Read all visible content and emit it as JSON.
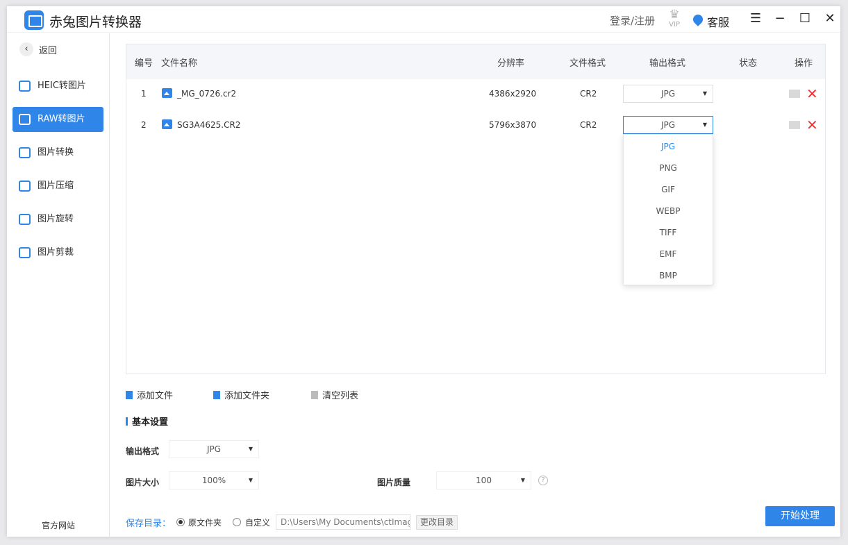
{
  "app": {
    "title": "赤兔图片转换器",
    "login": "登录/注册",
    "vip": "VIP",
    "support": "客服"
  },
  "sidebar": {
    "back": "返回",
    "items": [
      {
        "label": "HEIC转图片",
        "active": false
      },
      {
        "label": "RAW转图片",
        "active": true
      },
      {
        "label": "图片转换",
        "active": false
      },
      {
        "label": "图片压缩",
        "active": false
      },
      {
        "label": "图片旋转",
        "active": false
      },
      {
        "label": "图片剪裁",
        "active": false
      }
    ],
    "website": "官方网站"
  },
  "table": {
    "headers": {
      "num": "编号",
      "name": "文件名称",
      "resolution": "分辨率",
      "format": "文件格式",
      "output": "输出格式",
      "status": "状态",
      "ops": "操作"
    },
    "rows": [
      {
        "num": "1",
        "name": "_MG_0726.cr2",
        "resolution": "4386x2920",
        "format": "CR2",
        "output": "JPG",
        "status": ""
      },
      {
        "num": "2",
        "name": "SG3A4625.CR2",
        "resolution": "5796x3870",
        "format": "CR2",
        "output": "JPG",
        "status": ""
      }
    ]
  },
  "dropdown": {
    "options": [
      "JPG",
      "PNG",
      "GIF",
      "WEBP",
      "TIFF",
      "EMF",
      "BMP"
    ],
    "selected": "JPG"
  },
  "actions": {
    "add_file": "添加文件",
    "add_folder": "添加文件夹",
    "clear": "清空列表"
  },
  "settings": {
    "title": "基本设置",
    "output_format_label": "输出格式",
    "output_format": "JPG",
    "size_label": "图片大小",
    "size": "100%",
    "quality_label": "图片质量",
    "quality": "100"
  },
  "save": {
    "label": "保存目录：",
    "option_original": "原文件夹",
    "option_custom": "自定义",
    "path": "D:\\Users\\My Documents\\ctImageC",
    "change": "更改目录"
  },
  "start": "开始处理"
}
